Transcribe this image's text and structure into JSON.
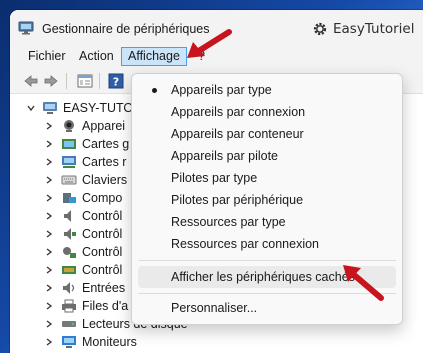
{
  "window": {
    "title": "Gestionnaire de périphériques",
    "watermark": "EasyTutoriel"
  },
  "menubar": {
    "items": [
      {
        "label": "Fichier"
      },
      {
        "label": "Action"
      },
      {
        "label": "Affichage",
        "active": true
      },
      {
        "label": "?"
      }
    ]
  },
  "tree": {
    "root": "EASY-TUTO",
    "rows": [
      {
        "label": "Apparei",
        "icon": "camera-icon"
      },
      {
        "label": "Cartes g",
        "icon": "display-adapter-icon"
      },
      {
        "label": "Cartes r",
        "icon": "network-adapter-icon"
      },
      {
        "label": "Claviers",
        "icon": "keyboard-icon"
      },
      {
        "label": "Compo",
        "icon": "software-component-icon"
      },
      {
        "label": "Contrôl",
        "icon": "audio-controller-icon"
      },
      {
        "label": "Contrôl",
        "icon": "storage-controller-icon"
      },
      {
        "label": "Contrôl",
        "icon": "usb-controller-icon"
      },
      {
        "label": "Contrôl",
        "icon": "port-controller-icon"
      },
      {
        "label": "Entrées",
        "icon": "audio-input-icon"
      },
      {
        "label": "Files d'a",
        "icon": "print-queue-icon"
      },
      {
        "label": "Lecteurs de disque",
        "icon": "disk-drive-icon"
      },
      {
        "label": "Moniteurs",
        "icon": "monitor-icon"
      }
    ]
  },
  "dropdown": {
    "items": [
      {
        "label": "Appareils par type",
        "checked": true
      },
      {
        "label": "Appareils par connexion"
      },
      {
        "label": "Appareils par conteneur"
      },
      {
        "label": "Appareils par pilote"
      },
      {
        "label": "Pilotes par type"
      },
      {
        "label": "Pilotes par périphérique"
      },
      {
        "label": "Ressources par type"
      },
      {
        "label": "Ressources par connexion"
      },
      {
        "label": "Afficher les périphériques cachés",
        "highlighted": true
      },
      {
        "label": "Personnaliser..."
      }
    ]
  },
  "colors": {
    "menu_active_bg": "#cce4f7",
    "menu_active_border": "#4c9ee8",
    "annotation_arrow": "#c8141e",
    "wallpaper": "#164aa8"
  }
}
